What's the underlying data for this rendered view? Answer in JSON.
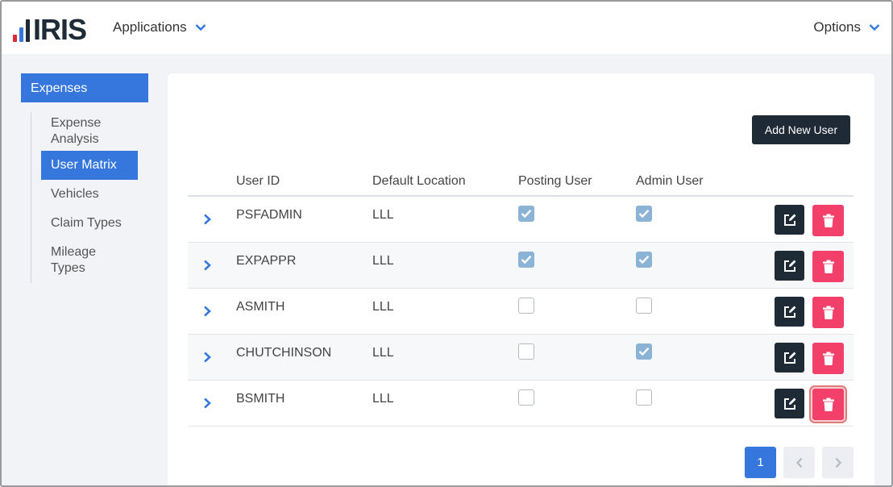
{
  "header": {
    "logo_text": "IRIS",
    "applications_label": "Applications",
    "options_label": "Options"
  },
  "sidebar": {
    "section": "Expenses",
    "items": [
      {
        "label": "Expense Analysis",
        "active": false
      },
      {
        "label": "User Matrix",
        "active": true
      },
      {
        "label": "Vehicles",
        "active": false
      },
      {
        "label": "Claim Types",
        "active": false
      },
      {
        "label": "Mileage Types",
        "active": false
      }
    ]
  },
  "toolbar": {
    "add_user_label": "Add New User"
  },
  "table": {
    "columns": [
      "User ID",
      "Default Location",
      "Posting User",
      "Admin User"
    ],
    "rows": [
      {
        "user_id": "PSFADMIN",
        "location": "LLL",
        "posting": true,
        "admin": true
      },
      {
        "user_id": "EXPAPPR",
        "location": "LLL",
        "posting": true,
        "admin": true
      },
      {
        "user_id": "ASMITH",
        "location": "LLL",
        "posting": false,
        "admin": false
      },
      {
        "user_id": "CHUTCHINSON",
        "location": "LLL",
        "posting": false,
        "admin": true
      },
      {
        "user_id": "BSMITH",
        "location": "LLL",
        "posting": false,
        "admin": false
      }
    ]
  },
  "pagination": {
    "current_page": "1",
    "prev_symbol": "‹",
    "next_symbol": "›"
  },
  "colors": {
    "accent": "#3577dd",
    "dark": "#1f2a37",
    "danger": "#f2406a",
    "checked": "#8ab3d6"
  }
}
